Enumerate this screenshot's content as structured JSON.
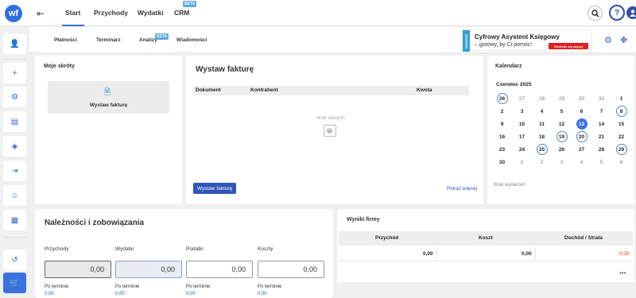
{
  "topnav": {
    "logo_text": "wf",
    "items": [
      "Start",
      "Przychody",
      "Wydatki",
      "CRM"
    ],
    "crm_badge": "BETA"
  },
  "subnav": {
    "items": [
      "Płatności",
      "Terminarz",
      "Analizy",
      "Wiadomości"
    ],
    "analizy_badge": "BETA"
  },
  "promo": {
    "tab": "NOWOŚĆ",
    "title": "Cyfrowy Asystent Księgowy",
    "subtitle": "– gotowy, by Ci pomóc!",
    "button": "Dowiedz się więcej"
  },
  "shortcuts": {
    "title": "Moje skróty",
    "tile_label": "Wystaw fakturę"
  },
  "invoices": {
    "title": "Wystaw fakturę",
    "columns": [
      "Dokument",
      "Kontrahent",
      "Kwota"
    ],
    "empty": "brak danych",
    "button": "Wystaw fakturę",
    "more": "Pokaż więcej"
  },
  "calendar": {
    "title": "Kalendarz",
    "month": "Czerwiec 2025",
    "days": [
      {
        "d": "26",
        "s": "ring"
      },
      {
        "d": "27",
        "s": "other"
      },
      {
        "d": "28",
        "s": "other"
      },
      {
        "d": "29",
        "s": "other"
      },
      {
        "d": "30",
        "s": "other"
      },
      {
        "d": "31",
        "s": "other"
      },
      {
        "d": "1",
        "s": ""
      },
      {
        "d": "2",
        "s": ""
      },
      {
        "d": "3",
        "s": ""
      },
      {
        "d": "4",
        "s": ""
      },
      {
        "d": "5",
        "s": ""
      },
      {
        "d": "6",
        "s": ""
      },
      {
        "d": "7",
        "s": ""
      },
      {
        "d": "8",
        "s": "ring"
      },
      {
        "d": "9",
        "s": ""
      },
      {
        "d": "10",
        "s": ""
      },
      {
        "d": "11",
        "s": ""
      },
      {
        "d": "12",
        "s": ""
      },
      {
        "d": "13",
        "s": "today"
      },
      {
        "d": "14",
        "s": ""
      },
      {
        "d": "15",
        "s": ""
      },
      {
        "d": "16",
        "s": ""
      },
      {
        "d": "17",
        "s": ""
      },
      {
        "d": "18",
        "s": ""
      },
      {
        "d": "19",
        "s": "ring"
      },
      {
        "d": "20",
        "s": "ring"
      },
      {
        "d": "21",
        "s": ""
      },
      {
        "d": "22",
        "s": ""
      },
      {
        "d": "23",
        "s": ""
      },
      {
        "d": "24",
        "s": ""
      },
      {
        "d": "25",
        "s": "ring"
      },
      {
        "d": "26",
        "s": ""
      },
      {
        "d": "27",
        "s": ""
      },
      {
        "d": "28",
        "s": ""
      },
      {
        "d": "29",
        "s": "ring"
      },
      {
        "d": "30",
        "s": ""
      },
      {
        "d": "1",
        "s": "other"
      },
      {
        "d": "2",
        "s": "other"
      },
      {
        "d": "3",
        "s": "other"
      },
      {
        "d": "4",
        "s": "other"
      },
      {
        "d": "5",
        "s": "other"
      },
      {
        "d": "6",
        "s": "other"
      }
    ],
    "empty": "Brak wydarzeń"
  },
  "finance": {
    "title": "Należności i zobowiązania",
    "cols": [
      {
        "label": "Przychody",
        "value": "0,00",
        "sub": "Po terminie",
        "subval": "0,00",
        "style": "grey"
      },
      {
        "label": "Wydatki",
        "value": "0,00",
        "sub": "Po terminie",
        "subval": "0,00",
        "style": "blue"
      },
      {
        "label": "Podatki",
        "value": "0,00",
        "sub": "Po terminie",
        "subval": "0,00",
        "style": ""
      },
      {
        "label": "Koszty",
        "value": "0,00",
        "sub": "Po terminie",
        "subval": "0,00",
        "style": ""
      }
    ]
  },
  "results": {
    "title": "Wyniki firmy",
    "columns": [
      "Przychód",
      "Koszt",
      "Dochód / Strata"
    ],
    "values": [
      "0,00",
      "0,00",
      "0,00"
    ],
    "more": "•••",
    "loss_color": "#e03030"
  }
}
